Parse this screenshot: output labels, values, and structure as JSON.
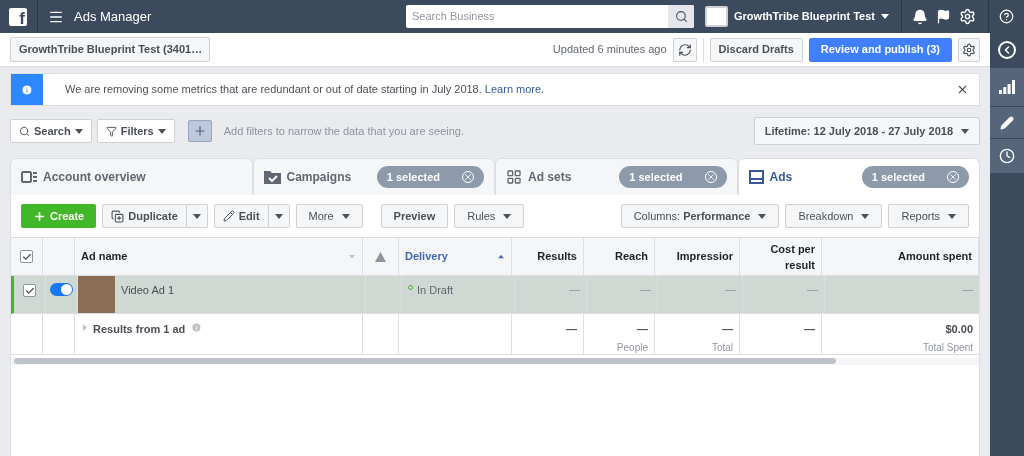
{
  "topbar": {
    "logo": "f",
    "title": "Ads Manager",
    "search_placeholder": "Search Business",
    "account": "GrowthTribe Blueprint Test"
  },
  "account_bar": {
    "account": "GrowthTribe Blueprint Test (3401…",
    "updated": "Updated 6 minutes ago",
    "buttons": [
      {
        "label": "Discard Drafts",
        "kind": "secondary"
      },
      {
        "label": "Review and publish (3)",
        "kind": "primary"
      }
    ]
  },
  "notice": {
    "text": "We are removing some metrics that are redundant or out of date starting in July 2018.",
    "link": "Learn more."
  },
  "filter_bar": {
    "search": "Search",
    "filters": "Filters",
    "placeholder": "Add filters to narrow the data that you are seeing.",
    "date_range": "Lifetime: 12 July 2018 - 27 July 2018"
  },
  "tabs": [
    {
      "label": "Account overview",
      "selected": false,
      "kind": "overview"
    },
    {
      "label": "Campaigns",
      "selected": false,
      "kind": "campaigns",
      "badge": "1 selected"
    },
    {
      "label": "Ad sets",
      "selected": false,
      "kind": "adsets",
      "badge": "1 selected"
    },
    {
      "label": "Ads",
      "selected": true,
      "kind": "ads",
      "badge": "1 selected"
    }
  ],
  "toolbar": {
    "left": [
      {
        "label": "Create",
        "kind": "create"
      },
      {
        "label": "Duplicate",
        "kind": "split"
      },
      {
        "label": "Edit",
        "kind": "split"
      },
      {
        "label": "More",
        "kind": "menu"
      },
      {
        "label": "Preview",
        "kind": "plain"
      },
      {
        "label": "Rules",
        "kind": "menu"
      }
    ],
    "right": [
      {
        "label": "Columns: **Performance**",
        "kind": "menu"
      },
      {
        "label": "Breakdown",
        "kind": "menu"
      },
      {
        "label": "Reports",
        "kind": "menu"
      }
    ]
  },
  "table": {
    "header_checked": true,
    "columns": [
      {
        "label": "Ad name",
        "kind": "name"
      },
      {
        "kind": "warning"
      },
      {
        "label": "Delivery",
        "kind": "delivery",
        "sorted": true
      },
      {
        "label": "Results",
        "kind": "metric"
      },
      {
        "label": "Reach",
        "kind": "metric"
      },
      {
        "label": "Impressior",
        "kind": "metric"
      },
      {
        "label": "Cost per result",
        "kind": "metric"
      },
      {
        "label": "Amount spent",
        "kind": "metric"
      }
    ],
    "rows": [
      {
        "selected": true,
        "checked": true,
        "on": true,
        "name": "Video Ad 1",
        "delivery": "In Draft",
        "values": [
          "—",
          "—",
          "—",
          "—",
          "—"
        ]
      }
    ],
    "summary": {
      "label": "Results from 1 ad",
      "cells": [
        {
          "value": "—"
        },
        {
          "value": "—",
          "sub": "People"
        },
        {
          "value": "—",
          "sub": "Total"
        },
        {
          "value": "—"
        },
        {
          "value": "$0.00",
          "sub": "Total Spent"
        }
      ]
    }
  }
}
